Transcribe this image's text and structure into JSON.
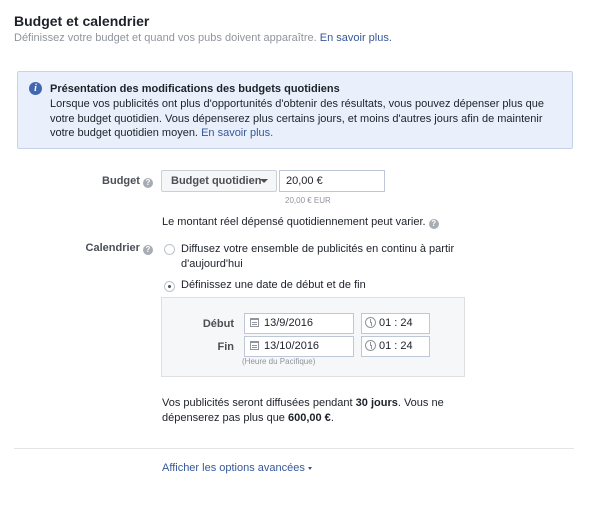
{
  "header": {
    "title": "Budget et calendrier",
    "subtitle": "Définissez votre budget et quand vos pubs doivent apparaître.",
    "learn_more": "En savoir plus."
  },
  "notice": {
    "title": "Présentation des modifications des budgets quotidiens",
    "body": "Lorsque vos publicités ont plus d'opportunités d'obtenir des résultats, vous pouvez dépenser plus que votre budget quotidien. Vous dépenserez plus certains jours, et moins d'autres jours afin de maintenir votre budget quotidien moyen.",
    "learn_more": "En savoir plus."
  },
  "budget": {
    "label": "Budget",
    "type_selected": "Budget quotidien",
    "amount": "20,00 €",
    "amount_hint": "20,00 € EUR",
    "variance_note": "Le montant réel dépensé quotidiennement peut varier."
  },
  "calendar": {
    "label": "Calendrier",
    "option_continuous": "Diffusez votre ensemble de publicités en continu à partir d'aujourd'hui",
    "option_dates": "Définissez une date de début et de fin",
    "selected_option": "option_dates",
    "start_label": "Début",
    "start_date": "13/9/2016",
    "start_time": "01 : 24",
    "end_label": "Fin",
    "end_date": "13/10/2016",
    "end_time": "01 : 24",
    "timezone": "(Heure du Pacifique)"
  },
  "summary": {
    "line1_prefix": "Vos publicités seront diffusées pendant ",
    "duration": "30 jours",
    "line1_suffix": ". Vous ne",
    "line2_prefix": "dépenserez pas plus que ",
    "max_spend": "600,00 €",
    "line2_suffix": "."
  },
  "advanced": {
    "label": "Afficher les options avancées"
  },
  "icons": {
    "info": "info-icon",
    "help": "question-icon",
    "calendar": "calendar-icon",
    "clock": "clock-icon",
    "dropdown": "chevron-down-icon"
  },
  "colors": {
    "link": "#365899",
    "notice_bg": "#eaf0fb",
    "info_icon": "#4267b2"
  }
}
